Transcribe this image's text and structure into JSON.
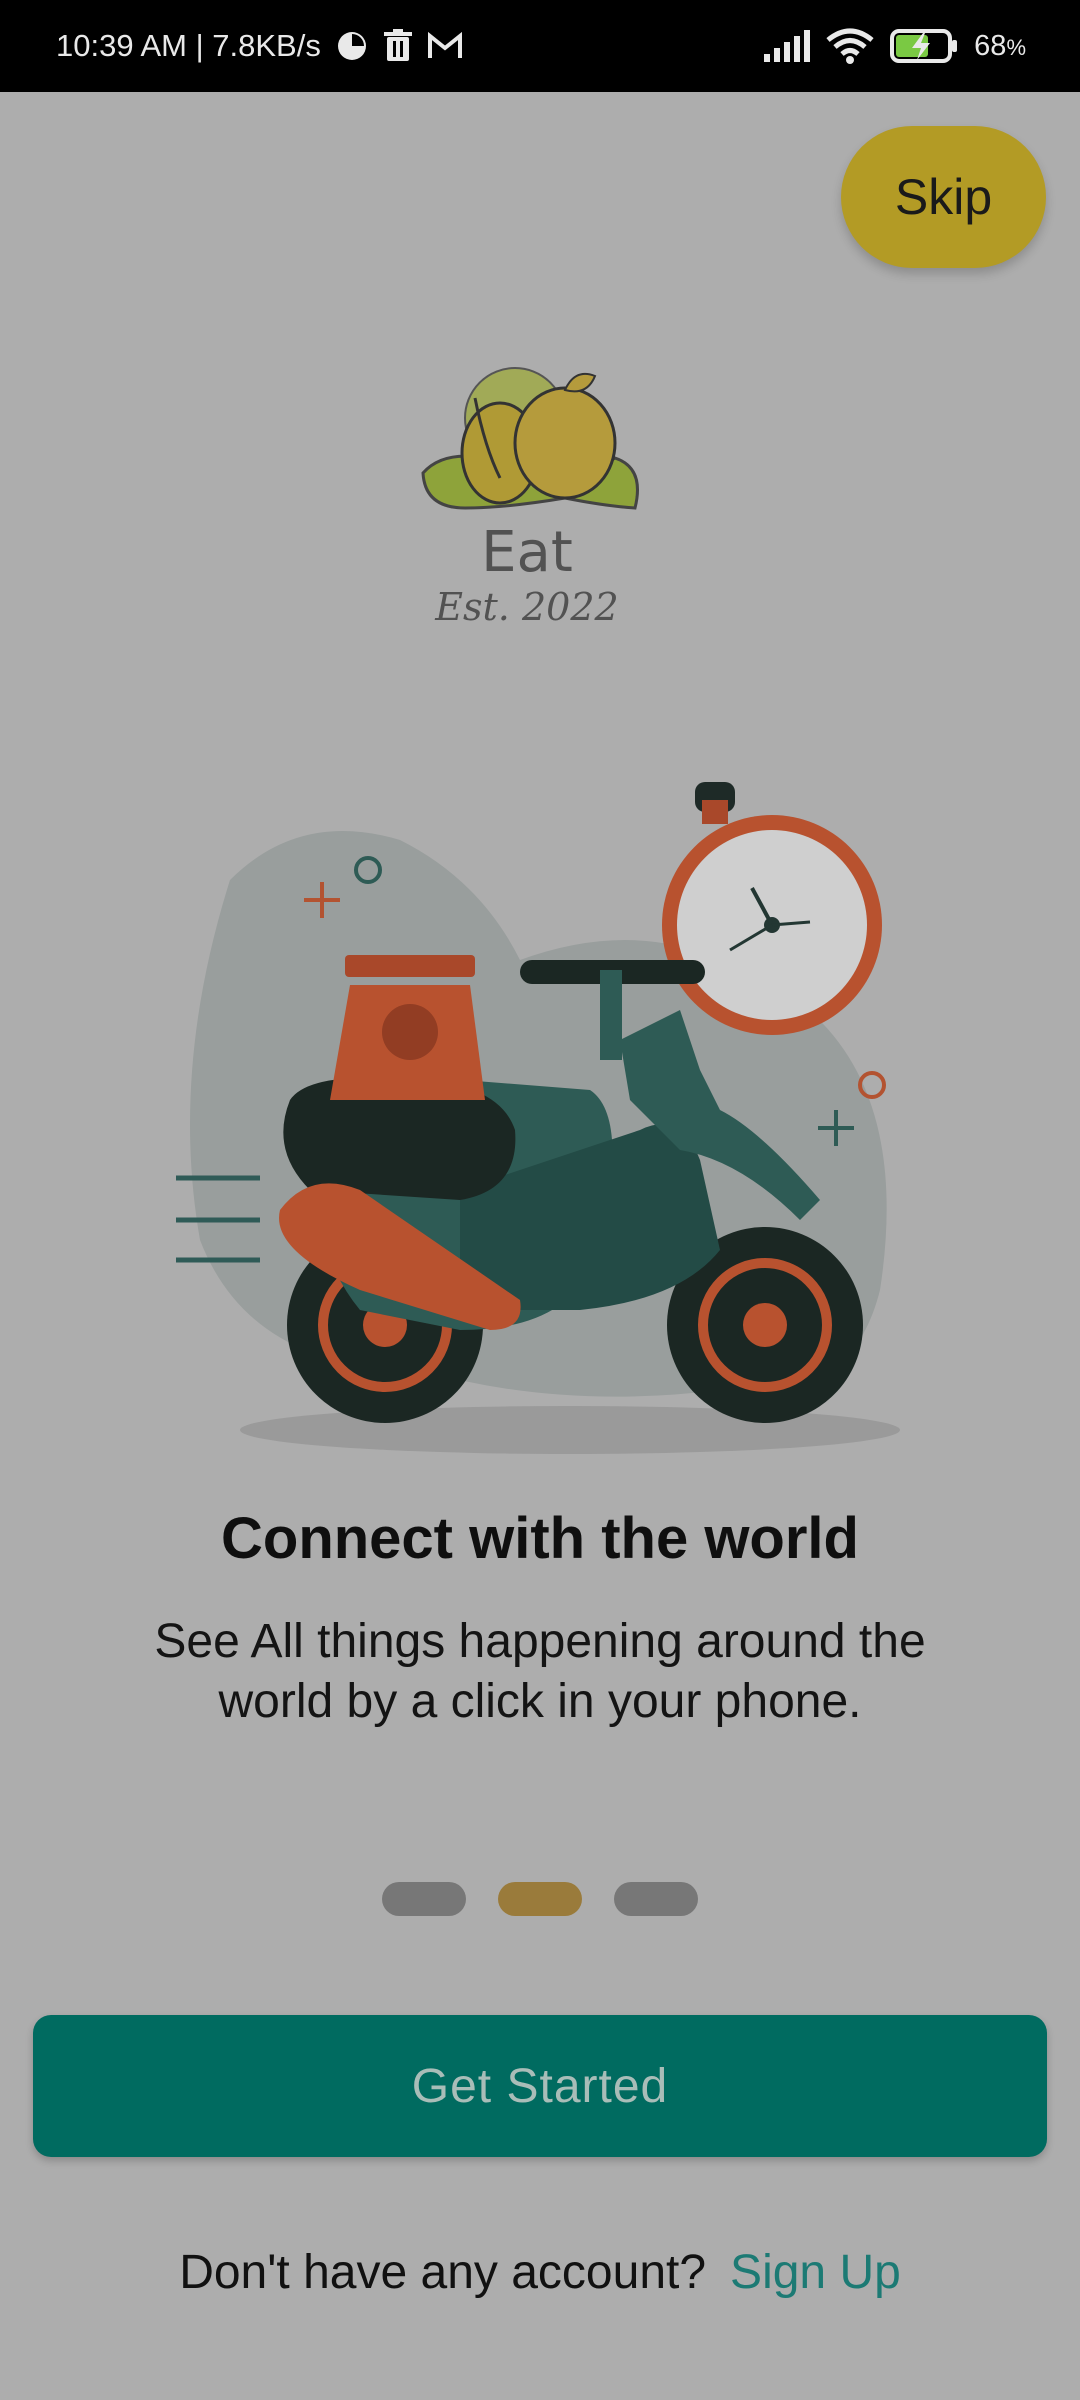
{
  "status_bar": {
    "time_speed": "10:39 AM | 7.8KB/s",
    "battery": "68",
    "battery_unit": "%",
    "icons_left": [
      "data-saver-icon",
      "trash-icon",
      "gmail-icon"
    ],
    "icons_right": [
      "signal-icon",
      "wifi-icon",
      "battery-charging-icon"
    ]
  },
  "skip_label": "Skip",
  "logo": {
    "name": "Eat",
    "est": "Est. 2022"
  },
  "headline": "Connect with the world",
  "subtitle_line1": "See All things happening around the",
  "subtitle_line2": "world by a click in your phone.",
  "pager": {
    "count": 3,
    "active_index": 1
  },
  "cta_label": "Get Started",
  "signup": {
    "question": "Don't have any account?",
    "link": "Sign Up"
  },
  "colors": {
    "accent": "#006b60",
    "skip": "#b39b25",
    "active_dot": "#9a7b3b",
    "link": "#1c7a74"
  }
}
